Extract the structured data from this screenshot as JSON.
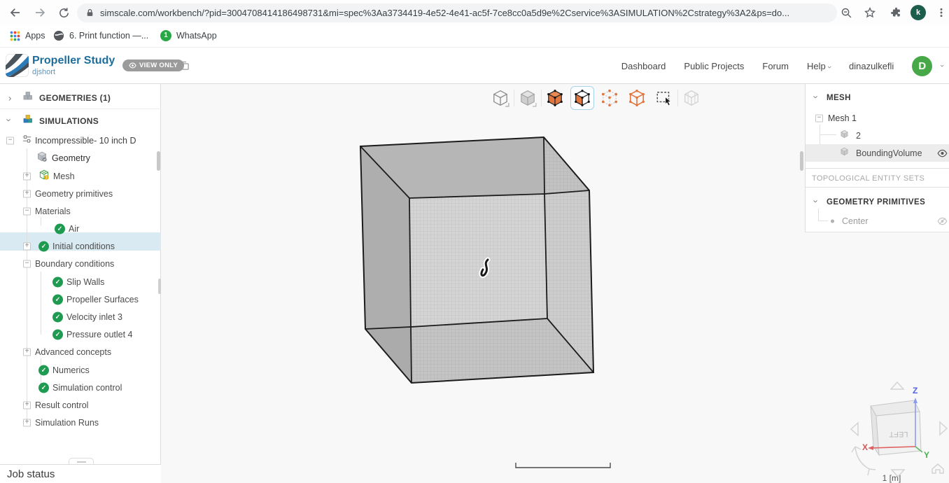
{
  "browser": {
    "url": "simscale.com/workbench/?pid=3004708414186498731&mi=spec%3Aa3734419-4e52-4e41-ac5f-7ce8cc0a5d9e%2Cservice%3ASIMULATION%2Cstrategy%3A2&ps=do...",
    "profile_initial": "k",
    "bookmarks_bar": {
      "apps_label": "Apps",
      "bookmark1": "6. Print function —...",
      "bookmark2": "WhatsApp",
      "bookmark2_badge": "1"
    }
  },
  "header": {
    "project_title": "Propeller Study",
    "project_owner": "djshort",
    "view_only_badge": "VIEW ONLY",
    "nav": [
      "Dashboard",
      "Public Projects",
      "Forum",
      "Help",
      "dinazulkefli"
    ],
    "avatar_initial": "D"
  },
  "sidebar": {
    "items": [
      {
        "label": "GEOMETRIES (1)"
      },
      {
        "label": "SIMULATIONS"
      },
      {
        "label": "Incompressible- 10 inch D"
      },
      {
        "label": "Geometry"
      },
      {
        "label": "Mesh"
      },
      {
        "label": "Geometry primitives"
      },
      {
        "label": "Materials"
      },
      {
        "label": "Air"
      },
      {
        "label": "Initial conditions"
      },
      {
        "label": "Boundary conditions"
      },
      {
        "label": "Slip Walls"
      },
      {
        "label": "Propeller Surfaces"
      },
      {
        "label": "Velocity inlet 3"
      },
      {
        "label": "Pressure outlet 4"
      },
      {
        "label": "Advanced concepts"
      },
      {
        "label": "Numerics"
      },
      {
        "label": "Simulation control"
      },
      {
        "label": "Result control"
      },
      {
        "label": "Simulation Runs"
      }
    ],
    "job_status_label": "Job status"
  },
  "toolbar": {
    "icons": [
      "wireframe-view",
      "solid-view",
      "volume-select",
      "face-select",
      "vertex-select",
      "edge-select",
      "box-select",
      "hidden-geometry"
    ],
    "selected": "face-select"
  },
  "right_panel": {
    "mesh_section": "MESH",
    "mesh_tree": [
      {
        "label": "Mesh 1"
      },
      {
        "label": "2"
      },
      {
        "label": "BoundingVolume"
      }
    ],
    "topological_section": "TOPOLOGICAL ENTITY SETS",
    "primitives_section": "GEOMETRY PRIMITIVES",
    "primitive_item": "Center"
  },
  "viewport": {
    "scale_bar_label": "1 [m]",
    "nav_cube_face": "LEFT",
    "axis_x": "X",
    "axis_y": "Y",
    "axis_z": "Z"
  },
  "colors": {
    "accent_blue": "#1e6e9c",
    "selection_row": "#d9eaf2",
    "check_green": "#1e9b50",
    "tool_orange": "#e2763f",
    "avatar_green": "#46a846",
    "chrome_avatar_green": "#1c5d4c",
    "highlight_gray": "#ececec"
  }
}
